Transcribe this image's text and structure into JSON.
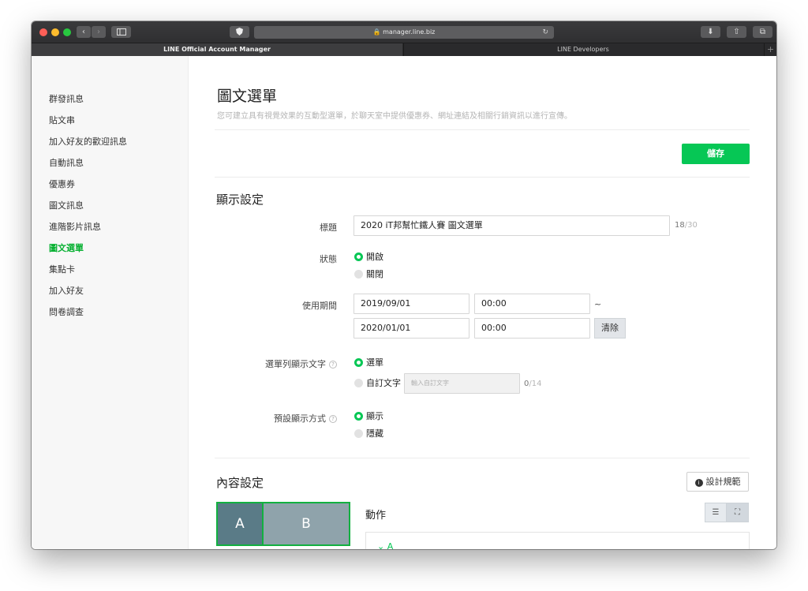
{
  "browser": {
    "url": "manager.line.biz",
    "tabs": [
      {
        "label": "LINE Official Account Manager",
        "active": true
      },
      {
        "label": "LINE Developers",
        "active": false
      }
    ],
    "add_tab": "+"
  },
  "sidebar": {
    "items": [
      {
        "label": "群發訊息"
      },
      {
        "label": "貼文串"
      },
      {
        "label": "加入好友的歡迎訊息"
      },
      {
        "label": "自動訊息"
      },
      {
        "label": "優惠券"
      },
      {
        "label": "圖文訊息"
      },
      {
        "label": "進階影片訊息"
      },
      {
        "label": "圖文選單",
        "active": true
      },
      {
        "label": "集點卡"
      },
      {
        "label": "加入好友"
      },
      {
        "label": "問卷調查"
      }
    ]
  },
  "page": {
    "title": "圖文選單",
    "description": "您可建立具有視覺效果的互動型選單，於聊天室中提供優惠券、網址連結及相關行銷資訊以進行宣傳。",
    "save_label": "儲存"
  },
  "display_settings": {
    "section_title": "顯示設定",
    "title_label": "標題",
    "title_value": "2020 iT邦幫忙鐵人賽 圖文選單",
    "title_count": "18",
    "title_max": "/30",
    "status_label": "狀態",
    "status_options": [
      "開啟",
      "關閉"
    ],
    "status_selected": "開啟",
    "period_label": "使用期間",
    "start_date": "2019/09/01",
    "start_time": "00:00",
    "end_date": "2020/01/01",
    "end_time": "00:00",
    "tilde": "~",
    "clear_label": "清除",
    "menu_bar_label": "選單列顯示文字",
    "menu_bar_options": [
      "選單",
      "自訂文字"
    ],
    "menu_bar_selected": "選單",
    "custom_text_placeholder": "輸入自訂文字",
    "custom_text_count": "0",
    "custom_text_max": "/14",
    "default_display_label": "預設顯示方式",
    "default_display_options": [
      "顯示",
      "隱藏"
    ],
    "default_display_selected": "顯示"
  },
  "content_settings": {
    "section_title": "內容設定",
    "guide_label": "設計規範",
    "areas": [
      "A",
      "B"
    ],
    "action_title": "動作",
    "action_item": "A"
  },
  "colors": {
    "brand_green": "#06c755",
    "active_nav": "#06b031"
  }
}
